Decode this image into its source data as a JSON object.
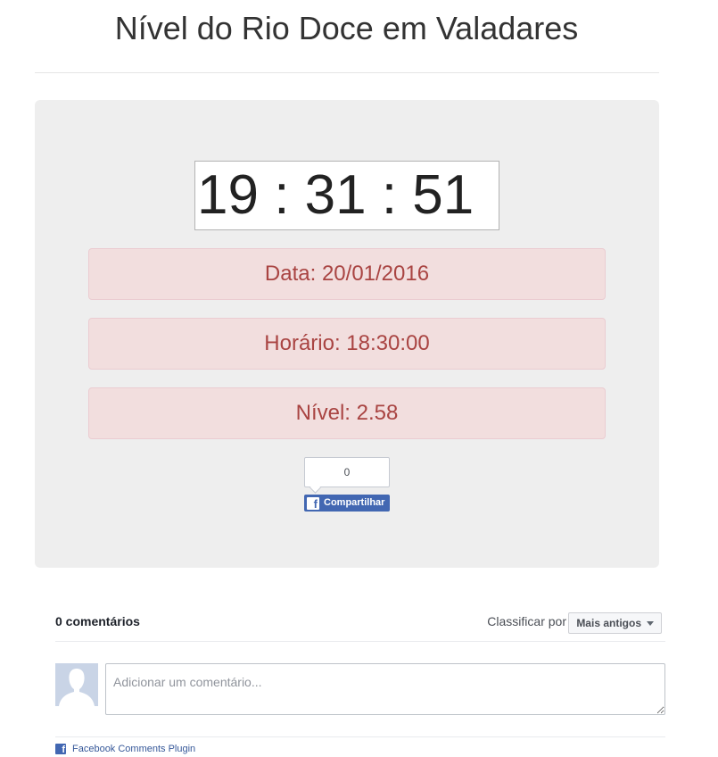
{
  "header": {
    "title": "Nível do Rio Doce em Valadares"
  },
  "clock": {
    "display": "19 : 31 : 51"
  },
  "readings": {
    "date": "Data: 20/01/2016",
    "time": "Horário: 18:30:00",
    "level": "Nível: 2.58"
  },
  "share": {
    "count": "0",
    "button_label": "Compartilhar",
    "icon": "facebook-f-icon",
    "brand_color": "#4267b2"
  },
  "comments": {
    "count_label": "0 comentários",
    "sort_label": "Classificar por",
    "sort_selected": "Mais antigos",
    "input_placeholder": "Adicionar um comentário...",
    "plugin_link": "Facebook Comments Plugin"
  },
  "colors": {
    "alert_text": "#a94442",
    "alert_background": "#f2dede",
    "panel_background": "#eeeeee"
  }
}
